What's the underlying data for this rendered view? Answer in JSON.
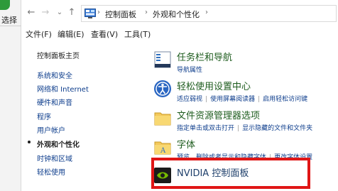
{
  "behind": {
    "label": "选择"
  },
  "nav": {
    "back": "←",
    "forward": "→",
    "recent": "⌄",
    "up": "↑",
    "breadcrumbs": [
      "控制面板",
      "外观和个性化"
    ],
    "separator": "›"
  },
  "menu": [
    "文件(F)",
    "编辑(E)",
    "查看(V)",
    "工具(T)"
  ],
  "left_pane": {
    "home": "控制面板主页",
    "items": [
      "系统和安全",
      "网络和 Internet",
      "硬件和声音",
      "程序",
      "用户帐户",
      "外观和个性化",
      "时钟和区域",
      "轻松使用"
    ],
    "active_index": 5
  },
  "categories": [
    {
      "title": "任务栏和导航",
      "links": [
        "导航属性"
      ],
      "icon": "taskbar-icon"
    },
    {
      "title": "轻松使用设置中心",
      "links": [
        "适应弱视",
        "使用屏幕阅读器",
        "启用轻松访问键"
      ],
      "icon": "ease-of-access-icon"
    },
    {
      "title": "文件资源管理器选项",
      "links": [
        "指定单击或双击打开",
        "显示隐藏的文件和文件夹"
      ],
      "icon": "folder-options-icon"
    },
    {
      "title": "字体",
      "links": [
        "预览、删除或者显示和隐藏字体",
        "更改字体设置"
      ],
      "icon": "fonts-icon"
    },
    {
      "title": "NVIDIA 控制面板",
      "links": [],
      "icon": "nvidia-icon"
    }
  ],
  "colors": {
    "highlight": "#e01616",
    "link": "#0d3d8c",
    "category_title": "#1e5c1e"
  }
}
